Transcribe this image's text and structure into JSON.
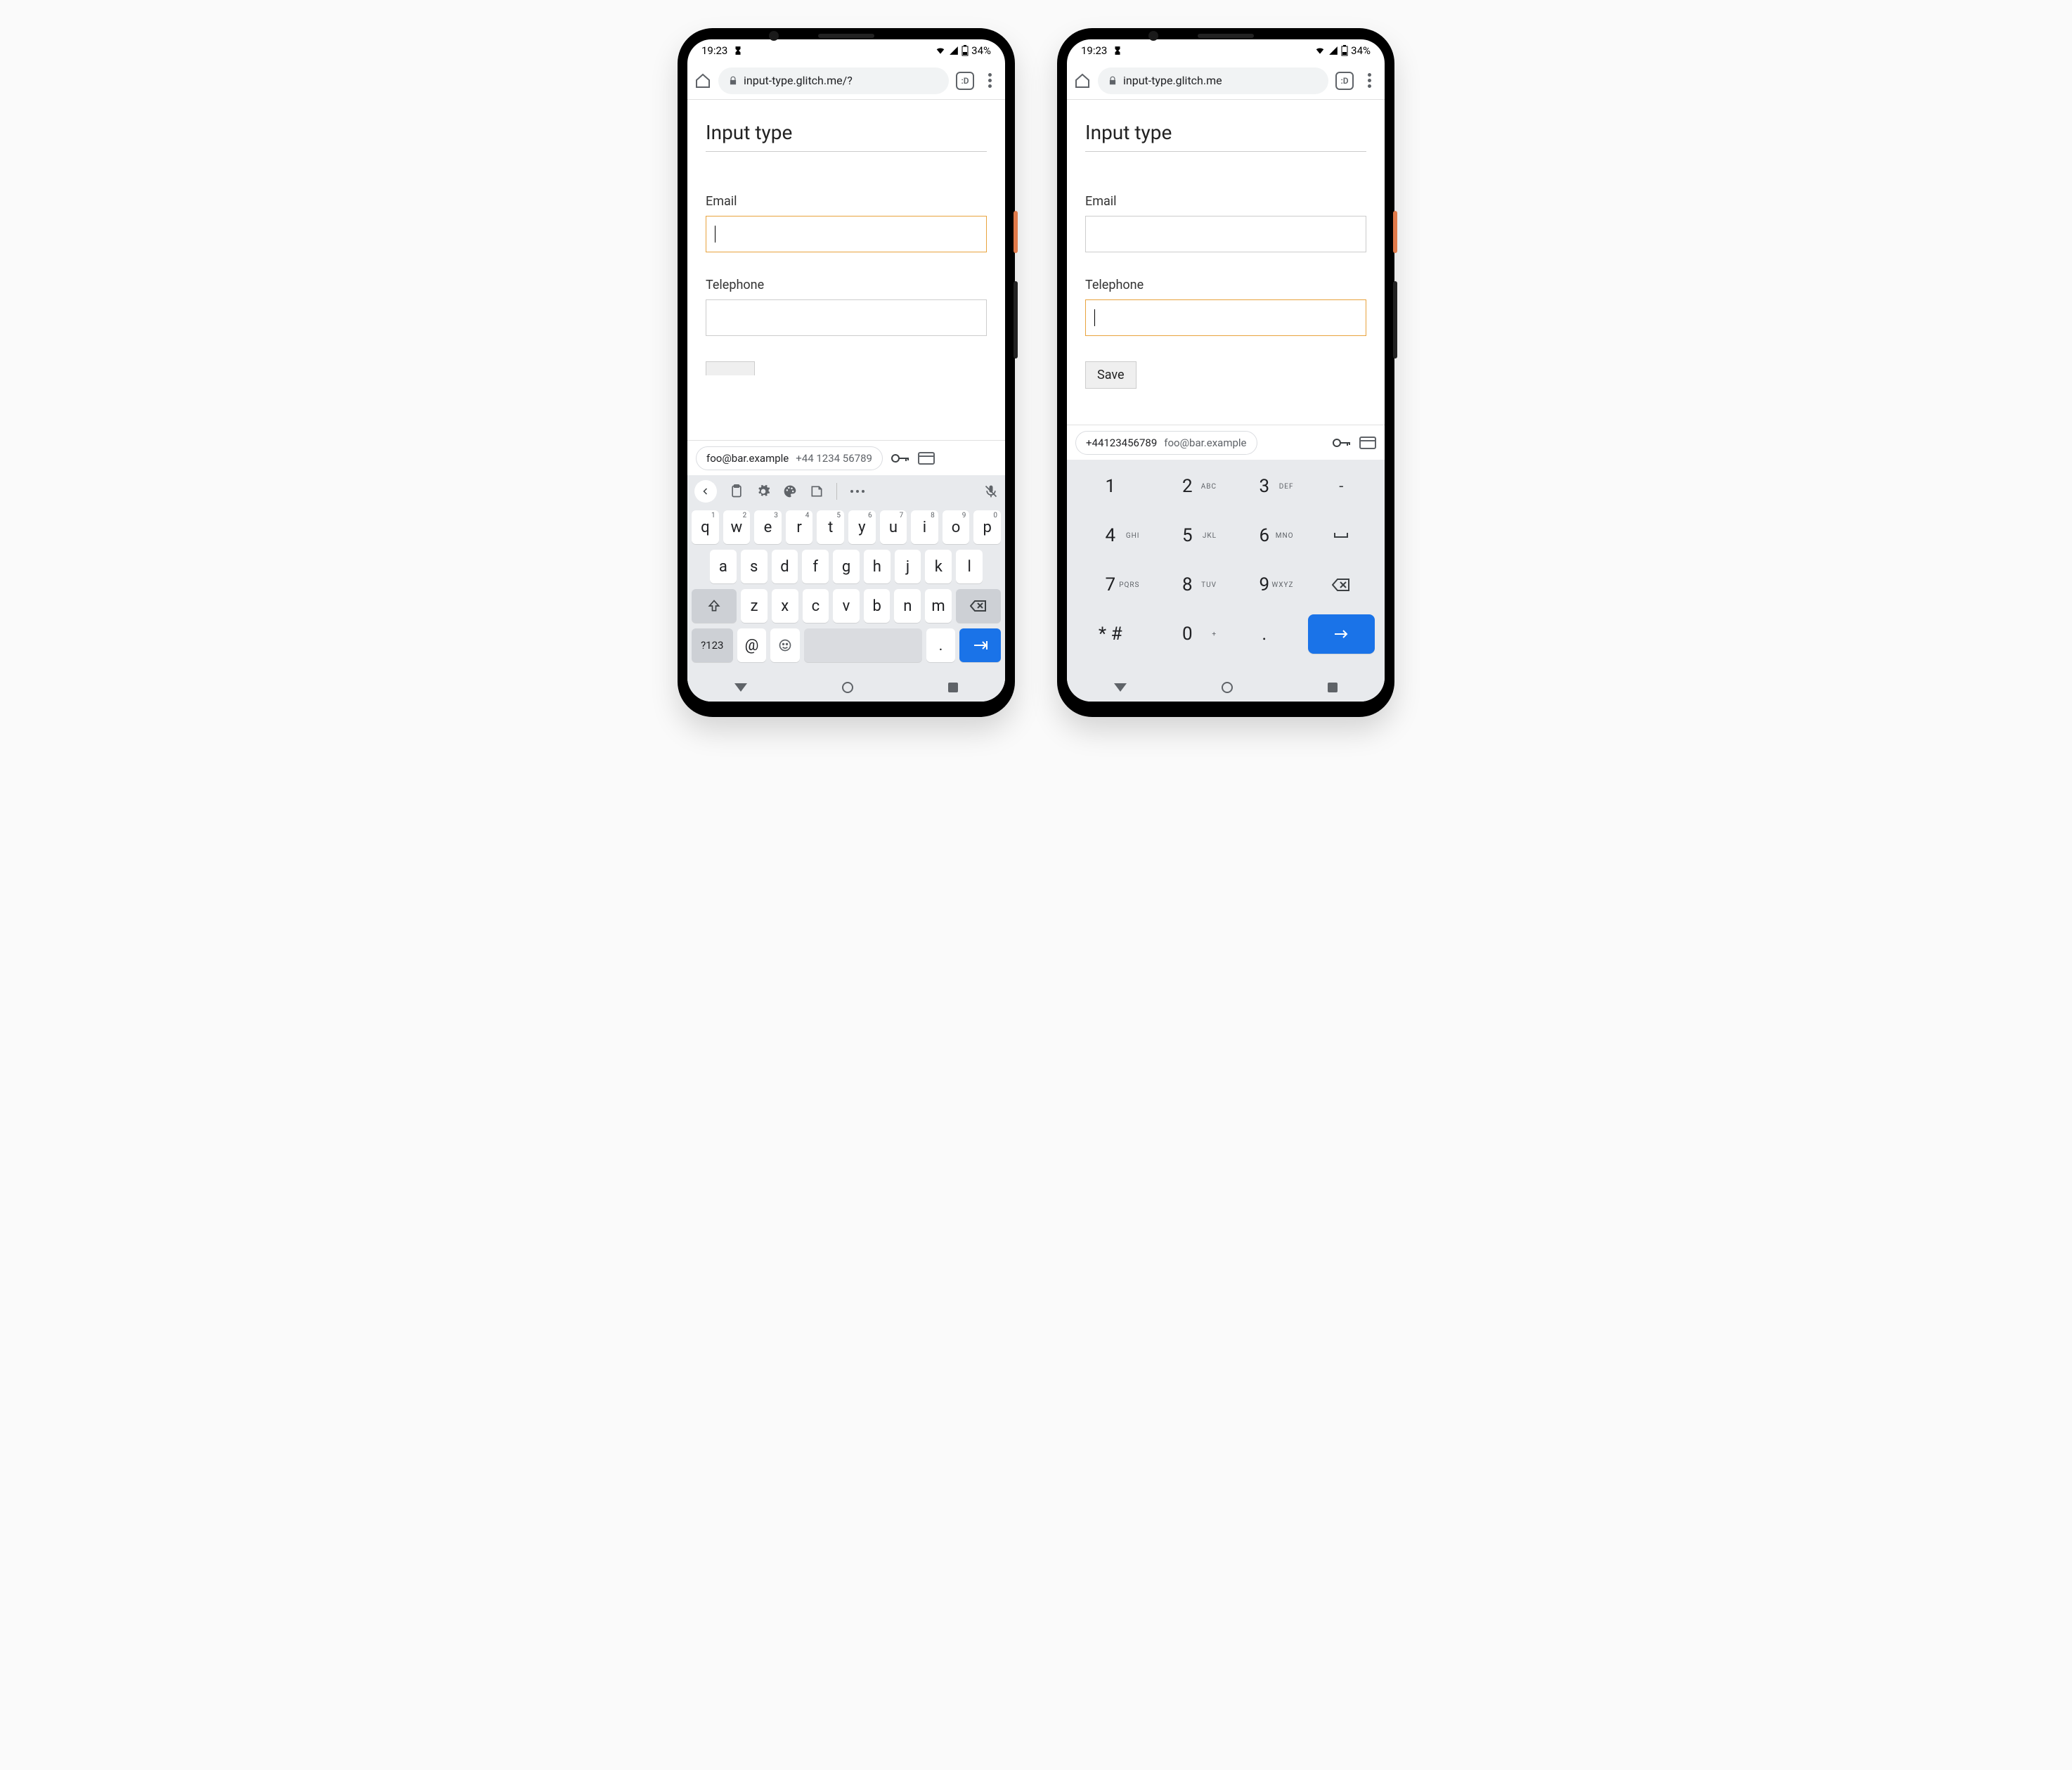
{
  "status": {
    "time": "19:23",
    "battery": "34%"
  },
  "browser": {
    "url_left": "input-type.glitch.me/?",
    "url_right": "input-type.glitch.me",
    "tab_label": ":D"
  },
  "page": {
    "title": "Input type",
    "email_label": "Email",
    "telephone_label": "Telephone",
    "save_label": "Save"
  },
  "autofill": {
    "left_primary": "foo@bar.example",
    "left_secondary": "+44 1234 56789",
    "right_primary": "+44123456789",
    "right_secondary": "foo@bar.example"
  },
  "qwerty": {
    "row1": [
      {
        "k": "q",
        "n": "1"
      },
      {
        "k": "w",
        "n": "2"
      },
      {
        "k": "e",
        "n": "3"
      },
      {
        "k": "r",
        "n": "4"
      },
      {
        "k": "t",
        "n": "5"
      },
      {
        "k": "y",
        "n": "6"
      },
      {
        "k": "u",
        "n": "7"
      },
      {
        "k": "i",
        "n": "8"
      },
      {
        "k": "o",
        "n": "9"
      },
      {
        "k": "p",
        "n": "0"
      }
    ],
    "row2": [
      "a",
      "s",
      "d",
      "f",
      "g",
      "h",
      "j",
      "k",
      "l"
    ],
    "row3": [
      "z",
      "x",
      "c",
      "v",
      "b",
      "n",
      "m"
    ],
    "symkey": "?123",
    "atkey": "@",
    "period": "."
  },
  "numpad": {
    "rows": [
      [
        {
          "k": "1",
          "t": ""
        },
        {
          "k": "2",
          "t": "ABC"
        },
        {
          "k": "3",
          "t": "DEF"
        },
        {
          "k": "-",
          "t": ""
        }
      ],
      [
        {
          "k": "4",
          "t": "GHI"
        },
        {
          "k": "5",
          "t": "JKL"
        },
        {
          "k": "6",
          "t": "MNO"
        },
        {
          "k": "␣",
          "t": ""
        }
      ],
      [
        {
          "k": "7",
          "t": "PQRS"
        },
        {
          "k": "8",
          "t": "TUV"
        },
        {
          "k": "9",
          "t": "WXYZ"
        },
        {
          "k": "⌫",
          "t": ""
        }
      ],
      [
        {
          "k": "* #",
          "t": ""
        },
        {
          "k": "0",
          "t": "+"
        },
        {
          "k": ".",
          "t": ""
        },
        {
          "k": "→",
          "t": ""
        }
      ]
    ]
  }
}
